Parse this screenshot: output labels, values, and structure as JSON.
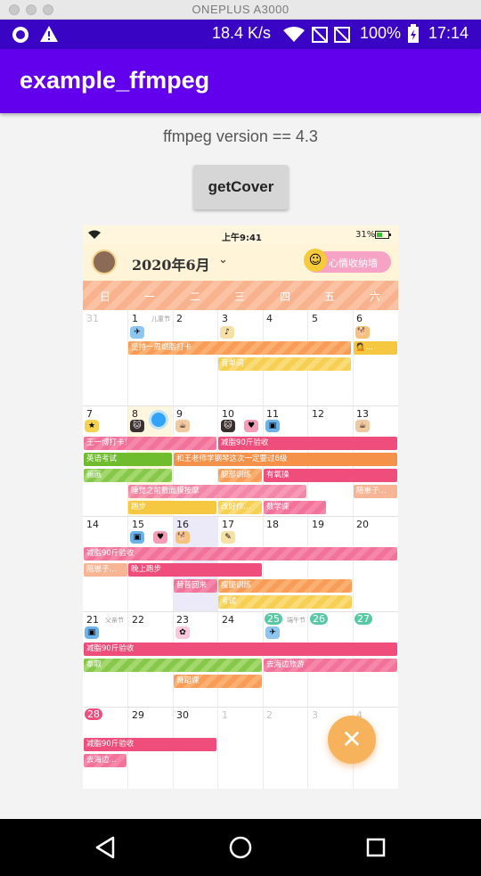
{
  "window": {
    "title": "ONEPLUS A3000"
  },
  "status_bar": {
    "speed": "18.4 K/s",
    "battery": "100%",
    "time": "17:14"
  },
  "app": {
    "title": "example_ffmpeg",
    "version_text": "ffmpeg version == 4.3",
    "button_label": "getCover"
  },
  "preview": {
    "ios_time": "上午9:41",
    "ios_battery": "31%",
    "month_title": "2020年6月",
    "mood_button": "心情收纳墙",
    "weekdays": [
      "日",
      "一",
      "二",
      "三",
      "四",
      "五",
      "六"
    ],
    "days": {
      "r1": [
        "31",
        "1",
        "2",
        "3",
        "4",
        "5",
        "6"
      ],
      "r2": [
        "7",
        "8",
        "9",
        "10",
        "11",
        "12",
        "13"
      ],
      "r3": [
        "14",
        "15",
        "16",
        "17",
        "18",
        "19",
        "20"
      ],
      "r4": [
        "21",
        "22",
        "23",
        "24",
        "25",
        "26",
        "27"
      ],
      "r5": [
        "28",
        "29",
        "30",
        "1",
        "2",
        "3",
        "4"
      ]
    },
    "holidays": {
      "childrens_day": "儿童节",
      "fathers_day": "父亲节",
      "dragon_boat": "端午节"
    },
    "events": {
      "e1": "坚持一周燃脂打卡",
      "e2": "背单词",
      "e3": "王一博打卡！",
      "e4": "减脂90斤验收",
      "e5": "英语考试",
      "e6": "和王老师学钢琴这次一定要过6级",
      "e7": "画画",
      "e8": "腿部训练",
      "e9": "有氧操",
      "e10": "睡觉之前敷面膜按摩",
      "e11": "陪崽子...",
      "e12": "跑步",
      "e13": "改好作...",
      "e14": "数学课",
      "e15": "减脂90斤验收",
      "e16": "陪崽子...",
      "e17": "晚上跑步",
      "e18": "替普回来",
      "e19": "瘦腿训练",
      "e20": "考试",
      "e21": "减脂90斤验收",
      "e22": "拳取",
      "e23": "去海边旅游",
      "e24": "舞蹈课",
      "e25": "减脂90斤验收",
      "e26": "去海边..."
    }
  }
}
